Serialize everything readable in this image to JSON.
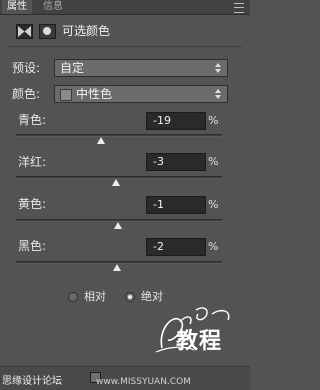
{
  "tabs": [
    {
      "label": "属性",
      "active": true
    },
    {
      "label": "信息",
      "active": false
    }
  ],
  "panel": {
    "title": "可选颜色"
  },
  "preset": {
    "label": "预设:",
    "value": "自定"
  },
  "colors": {
    "label": "颜色:",
    "value": "中性色"
  },
  "sliders": [
    {
      "label": "青色:",
      "value": "-19",
      "unit": "%",
      "level_fraction": 0.415
    },
    {
      "label": "洋红:",
      "value": "-3",
      "unit": "%",
      "level_fraction": 0.485
    },
    {
      "label": "黄色:",
      "value": "-1",
      "unit": "%",
      "level_fraction": 0.495
    },
    {
      "label": "黑色:",
      "value": "-2",
      "unit": "%",
      "level_fraction": 0.49
    }
  ],
  "method": {
    "options": [
      {
        "label": "相对",
        "checked": false
      },
      {
        "label": "绝对",
        "checked": true
      }
    ]
  },
  "watermark": {
    "script": "Lan Yue Xin",
    "big": "教程"
  },
  "footer": {
    "left": "思缘设计论坛",
    "right": "www.MISSYUAN.COM"
  },
  "colors_palette": {
    "panel_bg": "#535353",
    "tab_bar": "#424242",
    "input_bg": "#2a2a2a",
    "select_bg": "#6b6b6b"
  }
}
